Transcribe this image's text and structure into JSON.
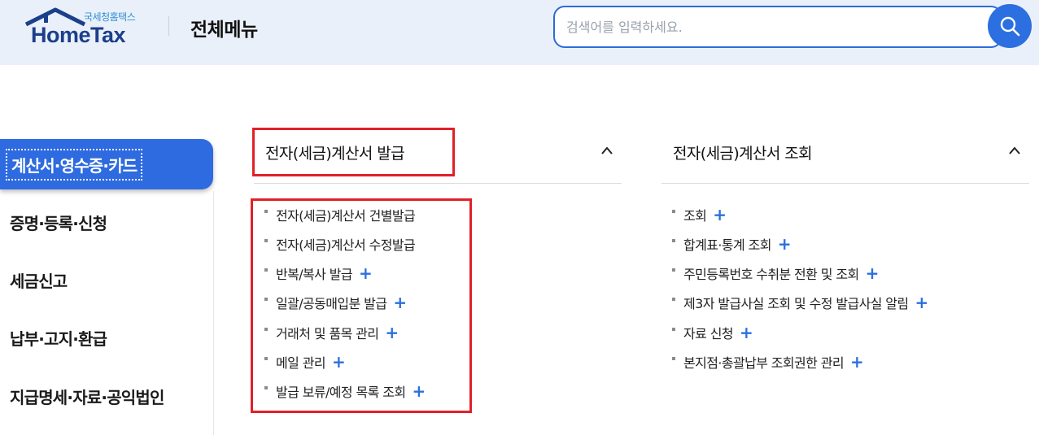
{
  "header": {
    "logo_small": "국세청홈택스",
    "logo_main": "HomeTax",
    "title": "전체메뉴",
    "search_placeholder": "검색어를 입력하세요."
  },
  "sidebar": {
    "items": [
      {
        "label": "계산서·영수증·카드",
        "active": true
      },
      {
        "label": "증명·등록·신청",
        "active": false
      },
      {
        "label": "세금신고",
        "active": false
      },
      {
        "label": "납부·고지·환급",
        "active": false
      },
      {
        "label": "지급명세·자료·공익법인",
        "active": false
      }
    ]
  },
  "sections": [
    {
      "title": "전자(세금)계산서 발급",
      "expanded": true,
      "items": [
        {
          "label": "전자(세금)계산서 건별발급",
          "plus": false
        },
        {
          "label": "전자(세금)계산서 수정발급",
          "plus": false
        },
        {
          "label": "반복/복사 발급",
          "plus": true
        },
        {
          "label": "일괄/공동매입분 발급",
          "plus": true
        },
        {
          "label": "거래처 및 품목 관리",
          "plus": true
        },
        {
          "label": "메일 관리",
          "plus": true
        },
        {
          "label": "발급 보류/예정 목록 조회",
          "plus": true
        }
      ]
    },
    {
      "title": "전자(세금)계산서 조회",
      "expanded": true,
      "items": [
        {
          "label": "조회",
          "plus": true
        },
        {
          "label": "합계표·통계 조회",
          "plus": true
        },
        {
          "label": "주민등록번호 수취분 전환 및 조회",
          "plus": true
        },
        {
          "label": "제3자 발급사실 조회 및 수정 발급사실 알림",
          "plus": true
        },
        {
          "label": "자료 신청",
          "plus": true
        },
        {
          "label": "본지점·총괄납부 조회권한 관리",
          "plus": true
        }
      ]
    }
  ],
  "icons": {
    "plus": "+",
    "search": "search-icon",
    "chevron": "chevron-up-icon"
  },
  "colors": {
    "accent": "#2f6be0",
    "header_bg": "#eaf0fa",
    "highlight": "#e1202a"
  }
}
